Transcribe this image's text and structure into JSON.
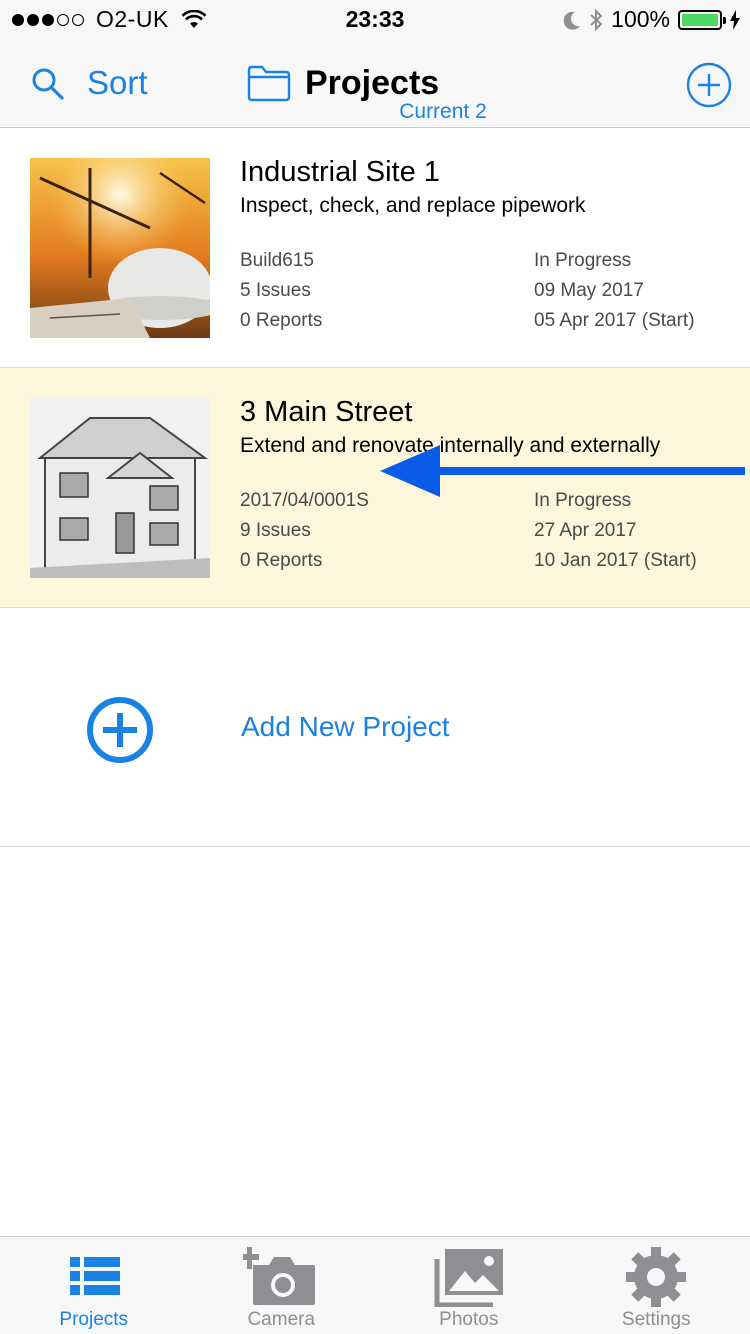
{
  "status_bar": {
    "carrier": "O2-UK",
    "time": "23:33",
    "battery_percent": "100%"
  },
  "nav": {
    "sort_label": "Sort",
    "title": "Projects",
    "subtitle": "Current 2"
  },
  "projects": [
    {
      "title": "Industrial Site 1",
      "description": "Inspect, check, and replace pipework",
      "reference": "Build615",
      "issues": "5 Issues",
      "reports": "0 Reports",
      "status": "In Progress",
      "date": "09 May 2017",
      "start": "05 Apr 2017 (Start)"
    },
    {
      "title": "3 Main Street",
      "description": "Extend and renovate internally and externally",
      "reference": "2017/04/0001S",
      "issues": "9 Issues",
      "reports": "0 Reports",
      "status": "In Progress",
      "date": "27 Apr 2017",
      "start": "10 Jan 2017 (Start)"
    }
  ],
  "add_project": {
    "label": "Add New Project"
  },
  "tabs": [
    {
      "label": "Projects",
      "icon": "list-icon",
      "active": true
    },
    {
      "label": "Camera",
      "icon": "camera-add-icon",
      "active": false
    },
    {
      "label": "Photos",
      "icon": "photos-icon",
      "active": false
    },
    {
      "label": "Settings",
      "icon": "gear-icon",
      "active": false
    }
  ],
  "colors": {
    "accent": "#1a82e2",
    "highlight_row": "#fdf6dc",
    "arrow": "#0a5be8",
    "inactive_tab": "#8e8e93"
  }
}
